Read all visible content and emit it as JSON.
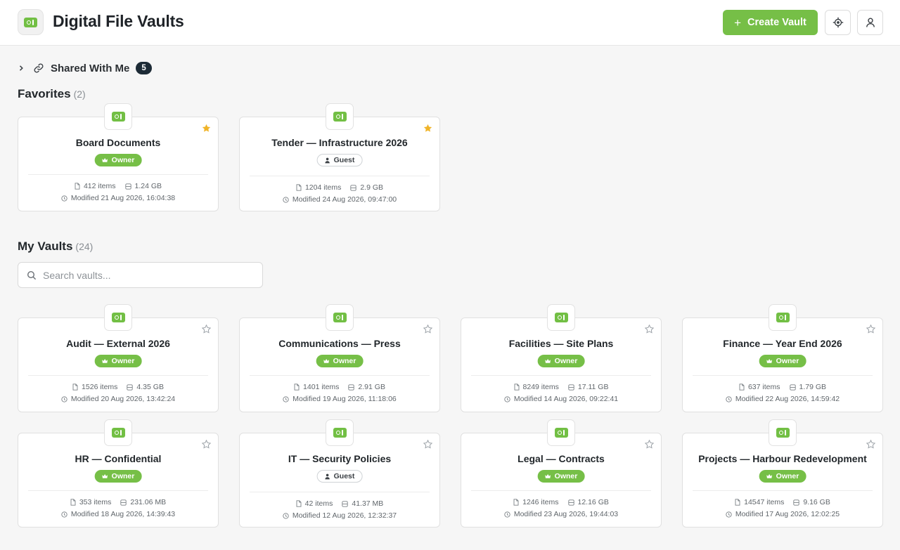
{
  "header": {
    "title": "Digital File Vaults",
    "create_label": "Create Vault"
  },
  "shared": {
    "label": "Shared With Me",
    "count": "5"
  },
  "favorites": {
    "title": "Favorites",
    "count": "(2)",
    "vaults": [
      {
        "name": "Board Documents",
        "role": "Owner",
        "items": "412 items",
        "size": "1.24 GB",
        "modified": "Modified 21 Aug 2026, 16:04:38",
        "favorite": true
      },
      {
        "name": "Tender — Infrastructure 2026",
        "role": "Guest",
        "items": "1204 items",
        "size": "2.9 GB",
        "modified": "Modified 24 Aug 2026, 09:47:00",
        "favorite": true
      }
    ]
  },
  "my_vaults": {
    "title": "My Vaults",
    "count": "(24)",
    "search_placeholder": "Search vaults...",
    "vaults": [
      {
        "name": "Audit — External 2026",
        "role": "Owner",
        "items": "1526 items",
        "size": "4.35 GB",
        "modified": "Modified 20 Aug 2026, 13:42:24",
        "favorite": false
      },
      {
        "name": "Communications — Press",
        "role": "Owner",
        "items": "1401 items",
        "size": "2.91 GB",
        "modified": "Modified 19 Aug 2026, 11:18:06",
        "favorite": false
      },
      {
        "name": "Facilities — Site Plans",
        "role": "Owner",
        "items": "8249 items",
        "size": "17.11 GB",
        "modified": "Modified 14 Aug 2026, 09:22:41",
        "favorite": false
      },
      {
        "name": "Finance — Year End 2026",
        "role": "Owner",
        "items": "637 items",
        "size": "1.79 GB",
        "modified": "Modified 22 Aug 2026, 14:59:42",
        "favorite": false
      },
      {
        "name": "HR — Confidential",
        "role": "Owner",
        "items": "353 items",
        "size": "231.06 MB",
        "modified": "Modified 18 Aug 2026, 14:39:43",
        "favorite": false
      },
      {
        "name": "IT — Security Policies",
        "role": "Guest",
        "items": "42 items",
        "size": "41.37 MB",
        "modified": "Modified 12 Aug 2026, 12:32:37",
        "favorite": false
      },
      {
        "name": "Legal — Contracts",
        "role": "Owner",
        "items": "1246 items",
        "size": "12.16 GB",
        "modified": "Modified 23 Aug 2026, 19:44:03",
        "favorite": false
      },
      {
        "name": "Projects — Harbour Redevelopment",
        "role": "Owner",
        "items": "14547 items",
        "size": "9.16 GB",
        "modified": "Modified 17 Aug 2026, 12:02:25",
        "favorite": false
      }
    ]
  },
  "colors": {
    "accent": "#76bf47",
    "star_active": "#f0b429",
    "pill_dark": "#1d2b36"
  },
  "icons": [
    "vault-icon",
    "plus-icon",
    "crosshair-icon",
    "user-icon",
    "chevron-right-icon",
    "link-icon",
    "search-icon",
    "star-icon",
    "crown-icon",
    "person-icon",
    "file-icon",
    "database-icon",
    "clock-icon"
  ]
}
